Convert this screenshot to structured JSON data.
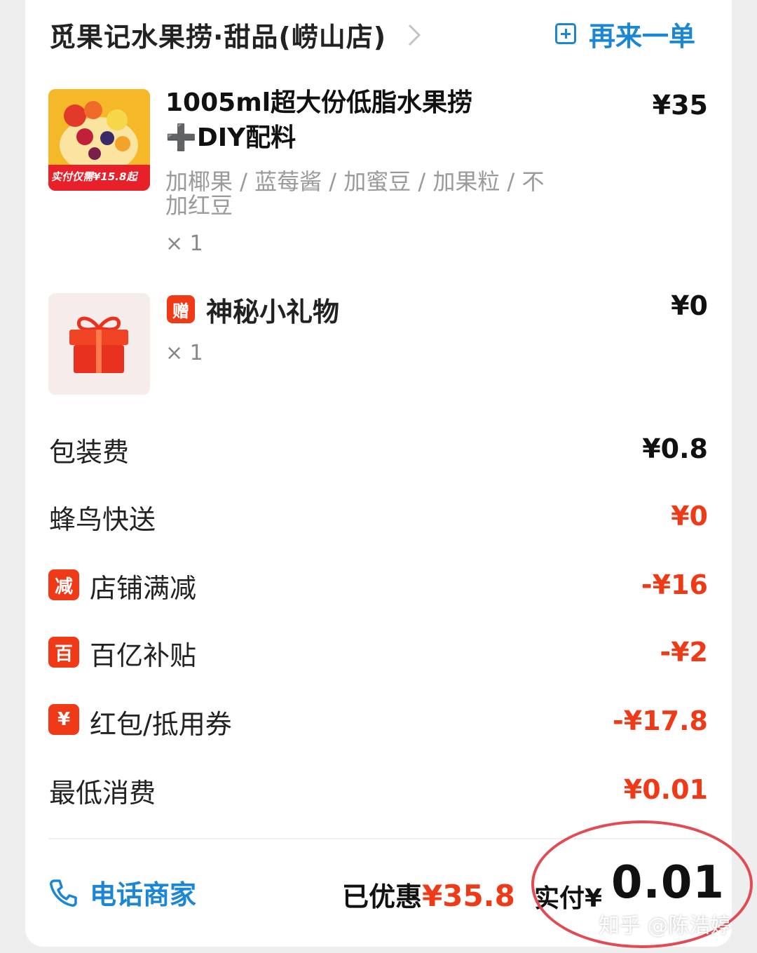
{
  "header": {
    "shop_name": "觅果记水果捞·甜品(崂山店)",
    "reorder_label": "再来一单"
  },
  "items": [
    {
      "name": "1005ml超大份低脂水果捞➕DIY配料",
      "price": "¥35",
      "options": "加椰果 / 蓝莓酱 / 加蜜豆 / 加果粒 / 不加红豆",
      "quantity": "× 1",
      "thumb_badge": "实付仅需¥15.8起"
    },
    {
      "badge": "赠",
      "name": "神秘小礼物",
      "price": "¥0",
      "quantity": "× 1"
    }
  ],
  "fees": {
    "packaging": {
      "label": "包装费",
      "value": "¥0.8"
    },
    "delivery": {
      "label": "蜂鸟快送",
      "value": "¥0"
    },
    "store_discount": {
      "badge": "减",
      "label": "店铺满减",
      "value": "-¥16"
    },
    "subsidy": {
      "badge": "百",
      "label": "百亿补贴",
      "value": "-¥2"
    },
    "coupon": {
      "badge": "¥",
      "label": "红包/抵用券",
      "value": "-¥17.8"
    },
    "min_charge": {
      "label": "最低消费",
      "value": "¥0.01"
    }
  },
  "footer": {
    "call_label": "电话商家",
    "saved_label": "已优惠",
    "saved_amount": "¥35.8",
    "paid_label": "实付",
    "paid_currency": "¥",
    "paid_amount": "0.01"
  },
  "watermark": "知乎 @陈浩婷",
  "colors": {
    "accent_blue": "#1b86d6",
    "discount_red": "#f03a17",
    "annotation_circle": "#e24b54"
  },
  "icons": [
    "chevron-right-icon",
    "plus-square-icon",
    "gift-icon",
    "phone-icon"
  ]
}
